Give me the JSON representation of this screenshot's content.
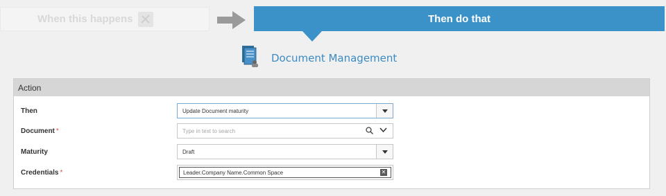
{
  "steps": {
    "when_label": "When this happens",
    "then_label": "Then do that"
  },
  "connector": {
    "title": "Document Management"
  },
  "panel": {
    "title": "Action",
    "rows": {
      "then": {
        "label": "Then",
        "value": "Update Document maturity"
      },
      "document": {
        "label": "Document",
        "placeholder": "Type in text to search"
      },
      "maturity": {
        "label": "Maturity",
        "value": "Draft"
      },
      "credentials": {
        "label": "Credentials",
        "tag": "Leader.Company Name.Common Space"
      }
    },
    "required_mark": "*"
  },
  "colors": {
    "accent": "#3b92c9",
    "required": "#e24b4b"
  }
}
